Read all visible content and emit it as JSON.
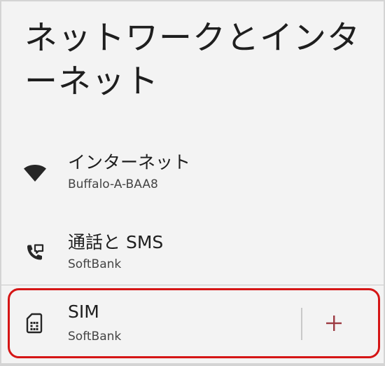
{
  "page": {
    "title": "ネットワークとインターネット"
  },
  "items": [
    {
      "label": "インターネット",
      "subtitle": "Buffalo-A-BAA8",
      "icon": "wifi-icon"
    },
    {
      "label": "通話と SMS",
      "subtitle": "SoftBank",
      "icon": "call-sms-icon"
    },
    {
      "label": "SIM",
      "subtitle": "SoftBank",
      "icon": "sim-card-icon",
      "action_icon": "add-icon"
    }
  ],
  "colors": {
    "highlight": "#d51515",
    "accent": "#9c3a42",
    "text": "#1e1e1e",
    "background": "#f3f3f3"
  }
}
